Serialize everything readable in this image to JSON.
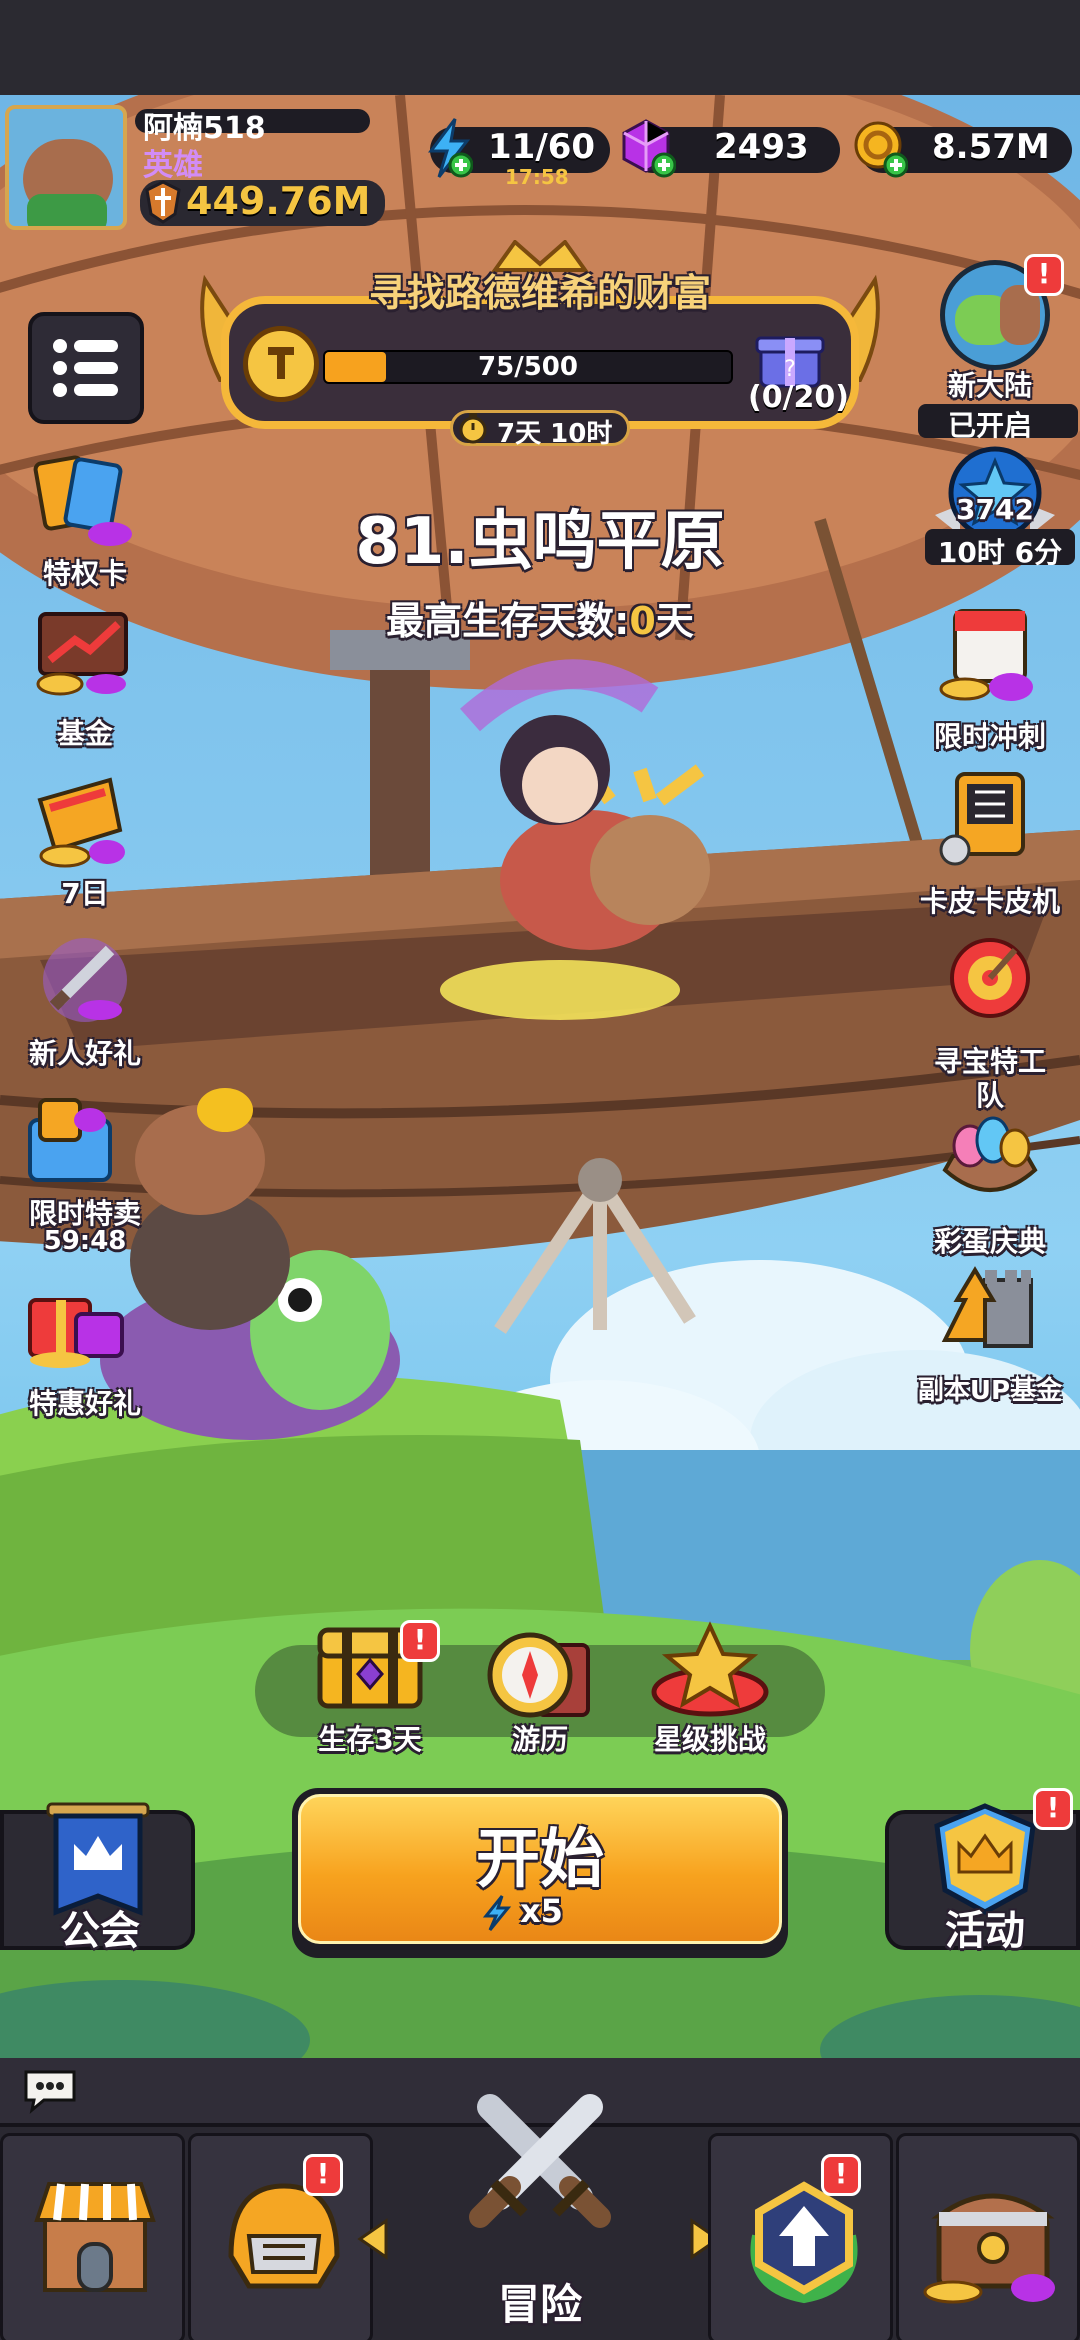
{
  "player": {
    "name": "阿楠518",
    "title": "英雄",
    "power": "449.76M"
  },
  "resources": {
    "energy": "11/60",
    "energy_timer": "17:58",
    "gems": "2493",
    "coins": "8.57M"
  },
  "event_banner": {
    "title": "寻找路德维希的财富",
    "progress_text": "75/500",
    "progress_value": 0.15,
    "reward_count": "(0/20)",
    "timer": "7天 10时"
  },
  "stage": {
    "name": "81.虫鸣平原",
    "record_label": "最高生存天数:",
    "record_value": "0",
    "record_unit": "天"
  },
  "left_menu": [
    {
      "label": "特权卡",
      "icon": "privilege-card-icon"
    },
    {
      "label": "基金",
      "icon": "fund-icon"
    },
    {
      "label": "7日",
      "icon": "seven-day-icon"
    },
    {
      "label": "新人好礼",
      "icon": "newbie-gift-icon"
    },
    {
      "label": "限时特卖",
      "sub": "59:48",
      "icon": "limited-sale-icon"
    },
    {
      "label": "特惠好礼",
      "icon": "special-gift-icon"
    }
  ],
  "right_menu": {
    "new_continent": {
      "label": "新大陆",
      "status": "已开启"
    },
    "star_rank": {
      "value": "3742",
      "timer": "10时 6分"
    },
    "items": [
      {
        "label": "限时冲刺",
        "icon": "limited-sprint-icon"
      },
      {
        "label": "卡皮卡皮机",
        "icon": "slot-machine-icon"
      },
      {
        "label": "寻宝特工",
        "label2": "队",
        "icon": "treasure-agent-icon"
      },
      {
        "label": "彩蛋庆典",
        "icon": "easter-egg-icon"
      },
      {
        "label": "副本UP基金",
        "icon": "dungeon-fund-icon"
      }
    ]
  },
  "mode_bar": [
    {
      "label": "生存3天"
    },
    {
      "label": "游历"
    },
    {
      "label": "星级挑战"
    }
  ],
  "start_button": {
    "label": "开始",
    "cost": "x5"
  },
  "guild_button": {
    "label": "公会"
  },
  "activity_button": {
    "label": "活动"
  },
  "bottom_nav": {
    "adventure_label": "冒险"
  },
  "badge": "!",
  "colors": {
    "accent_orange": "#f7a21e",
    "badge_red": "#ee3b3b",
    "gem_purple": "#b832e6",
    "gold": "#f5c542"
  }
}
